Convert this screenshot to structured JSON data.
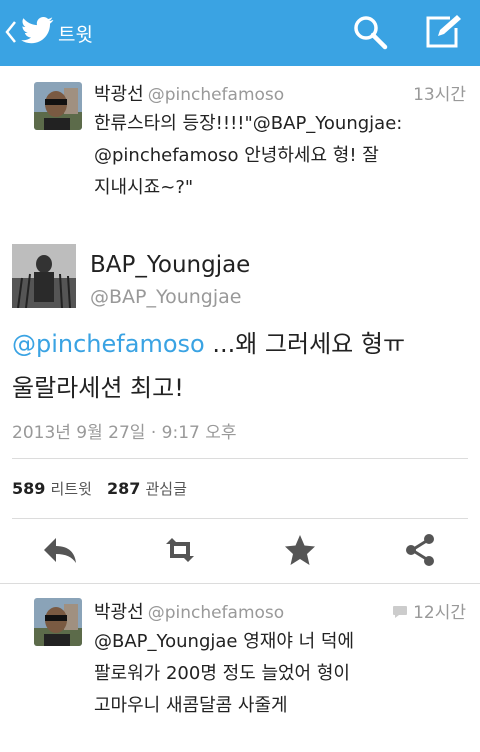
{
  "header": {
    "title": "트윗"
  },
  "tweets_above": [
    {
      "name": "박광선",
      "handle": "@pinchefamoso",
      "time": "13시간",
      "lines": [
        "한류스타의 등장!!!!\"@BAP_Youngjae:",
        "@pinchefamoso 안녕하세요 형! 잘",
        "지내시죠~?\""
      ]
    }
  ],
  "main_tweet": {
    "name": "BAP_Youngjae",
    "handle": "@BAP_Youngjae",
    "mention": "@pinchefamoso",
    "text_rest": " ...왜 그러세요 형ㅠ",
    "text_line2": "울랄라세션 최고!",
    "date": "2013년 9월 27일 · 9:17 오후",
    "retweets_count": "589",
    "retweets_label": "리트윗",
    "favorites_count": "287",
    "favorites_label": "관심글"
  },
  "tweets_below": [
    {
      "name": "박광선",
      "handle": "@pinchefamoso",
      "time": "12시간",
      "lines": [
        "@BAP_Youngjae 영재야 너 덕에",
        "팔로워가 200명 정도 늘었어 형이",
        "고마우니 새콤달콤 사줄게"
      ]
    }
  ],
  "colors": {
    "accent": "#3aa3e3",
    "muted": "#999999"
  },
  "icons": [
    "back-chevron-icon",
    "twitter-bird-icon",
    "search-icon",
    "compose-icon",
    "reply-icon",
    "retweet-icon",
    "favorite-star-icon",
    "share-icon",
    "reply-bubble-icon"
  ]
}
